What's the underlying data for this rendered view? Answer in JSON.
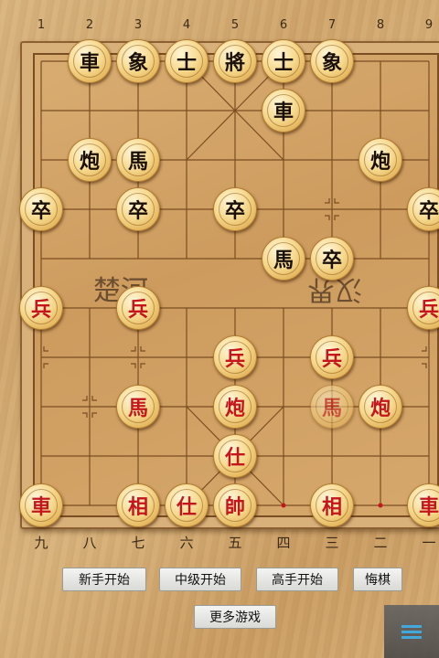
{
  "column_numbers": [
    "1",
    "2",
    "3",
    "4",
    "5",
    "6",
    "7",
    "8",
    "9"
  ],
  "column_chinese": [
    "九",
    "八",
    "七",
    "六",
    "五",
    "四",
    "三",
    "二",
    "一"
  ],
  "river": {
    "left": "楚河",
    "right": "汉界"
  },
  "pieces": [
    {
      "id": "b-che-1",
      "text": "車",
      "side": "black",
      "col": 2,
      "row": 0
    },
    {
      "id": "b-xiang-1",
      "text": "象",
      "side": "black",
      "col": 3,
      "row": 0
    },
    {
      "id": "b-shi-1",
      "text": "士",
      "side": "black",
      "col": 4,
      "row": 0
    },
    {
      "id": "b-jiang",
      "text": "將",
      "side": "black",
      "col": 5,
      "row": 0
    },
    {
      "id": "b-shi-2",
      "text": "士",
      "side": "black",
      "col": 6,
      "row": 0
    },
    {
      "id": "b-xiang-2",
      "text": "象",
      "side": "black",
      "col": 7,
      "row": 0
    },
    {
      "id": "b-che-2",
      "text": "車",
      "side": "black",
      "col": 6,
      "row": 1
    },
    {
      "id": "b-pao-1",
      "text": "炮",
      "side": "black",
      "col": 2,
      "row": 2
    },
    {
      "id": "b-ma-1",
      "text": "馬",
      "side": "black",
      "col": 3,
      "row": 2
    },
    {
      "id": "b-pao-2",
      "text": "炮",
      "side": "black",
      "col": 8,
      "row": 2
    },
    {
      "id": "b-zu-1",
      "text": "卒",
      "side": "black",
      "col": 1,
      "row": 3
    },
    {
      "id": "b-zu-2",
      "text": "卒",
      "side": "black",
      "col": 3,
      "row": 3
    },
    {
      "id": "b-zu-3",
      "text": "卒",
      "side": "black",
      "col": 5,
      "row": 3
    },
    {
      "id": "b-zu-4",
      "text": "卒",
      "side": "black",
      "col": 9,
      "row": 3
    },
    {
      "id": "b-ma-2",
      "text": "馬",
      "side": "black",
      "col": 6,
      "row": 4
    },
    {
      "id": "b-zu-5",
      "text": "卒",
      "side": "black",
      "col": 7,
      "row": 4
    },
    {
      "id": "r-bing-1",
      "text": "兵",
      "side": "red",
      "col": 1,
      "row": 5
    },
    {
      "id": "r-bing-2",
      "text": "兵",
      "side": "red",
      "col": 3,
      "row": 5
    },
    {
      "id": "r-bing-3",
      "text": "兵",
      "side": "red",
      "col": 9,
      "row": 5
    },
    {
      "id": "r-bing-4",
      "text": "兵",
      "side": "red",
      "col": 5,
      "row": 6
    },
    {
      "id": "r-bing-5",
      "text": "兵",
      "side": "red",
      "col": 7,
      "row": 6
    },
    {
      "id": "r-ma-1",
      "text": "馬",
      "side": "red",
      "col": 3,
      "row": 7
    },
    {
      "id": "r-pao-1",
      "text": "炮",
      "side": "red",
      "col": 5,
      "row": 7
    },
    {
      "id": "r-ma-2",
      "text": "馬",
      "side": "red",
      "col": 7,
      "row": 7,
      "faded": true
    },
    {
      "id": "r-pao-2",
      "text": "炮",
      "side": "red",
      "col": 8,
      "row": 7
    },
    {
      "id": "r-shi-1",
      "text": "仕",
      "side": "red",
      "col": 5,
      "row": 8
    },
    {
      "id": "r-che-1",
      "text": "車",
      "side": "red",
      "col": 1,
      "row": 9
    },
    {
      "id": "r-xiang-1",
      "text": "相",
      "side": "red",
      "col": 3,
      "row": 9
    },
    {
      "id": "r-shi-2",
      "text": "仕",
      "side": "red",
      "col": 4,
      "row": 9
    },
    {
      "id": "r-shuai",
      "text": "帥",
      "side": "red",
      "col": 5,
      "row": 9
    },
    {
      "id": "r-xiang-2",
      "text": "相",
      "side": "red",
      "col": 7,
      "row": 9
    },
    {
      "id": "r-che-2",
      "text": "車",
      "side": "red",
      "col": 9,
      "row": 9
    }
  ],
  "buttons": {
    "new_beginner": "新手开始",
    "intermediate": "中级开始",
    "expert": "高手开始",
    "undo": "悔棋",
    "more_games": "更多游戏"
  },
  "icons": {
    "menu": "hamburger-menu-icon"
  },
  "colors": {
    "red_piece": "#c4161c",
    "black_piece": "#1a1008",
    "menu_accent": "#2aa8ef"
  }
}
